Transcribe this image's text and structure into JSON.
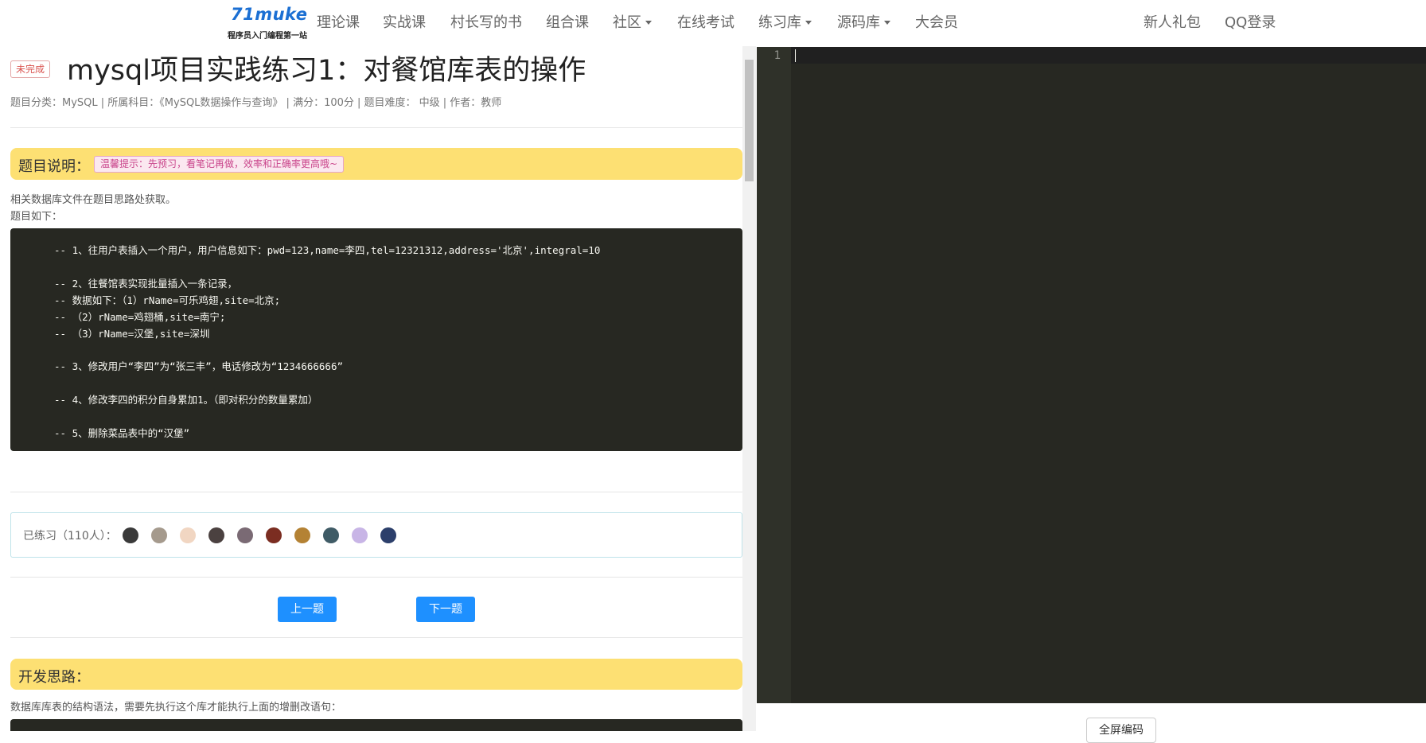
{
  "nav": {
    "logo_text": "71muke",
    "logo_tagline": "程序员入门编程第一站",
    "items": [
      {
        "label": "理论课"
      },
      {
        "label": "实战课"
      },
      {
        "label": "村长写的书"
      },
      {
        "label": "组合课"
      },
      {
        "label": "社区"
      },
      {
        "label": "在线考试"
      },
      {
        "label": "练习库"
      },
      {
        "label": "源码库"
      },
      {
        "label": "大会员"
      }
    ],
    "gift": "新人礼包",
    "login": "QQ登录"
  },
  "problem": {
    "status": "未完成",
    "title": "mysql项目实践练习1：对餐馆库表的操作",
    "meta": "题目分类：MySQL | 所属科目：《MySQL数据操作与查询》 | 满分：100分 | 题目难度： 中级 | 作者：教师"
  },
  "description": {
    "heading": "题目说明：",
    "tip": "温馨提示：先预习，看笔记再做，效率和正确率更高哦~",
    "line1": "相关数据库文件在题目思路处获取。",
    "line2": "题目如下：",
    "code_lines": [
      "-- 1、往用户表插入一个用户，用户信息如下：pwd=123,name=李四,tel=12321312,address='北京',integral=10",
      "-- 2、往餐馆表实现批量插入一条记录，",
      "-- 数据如下：（1）rName=可乐鸡翅,site=北京;",
      "-- （2）rName=鸡翅桶,site=南宁;",
      "-- （3）rName=汉堡,site=深圳",
      "-- 3、修改用户“李四”为“张三丰”，电话修改为“1234666666”",
      "-- 4、修改李四的积分自身累加1。（即对积分的数量累加）",
      "-- 5、删除菜品表中的“汉堡”"
    ]
  },
  "practice": {
    "label": "已练习（110人）："
  },
  "buttons": {
    "prev": "上一题",
    "next": "下一题"
  },
  "thoughts": {
    "heading": "开发思路：",
    "line1": "数据库库表的结构语法，需要先执行这个库才能执行上面的增删改语句："
  },
  "editor": {
    "line_number": "1",
    "fullscreen": "全屏编码"
  }
}
